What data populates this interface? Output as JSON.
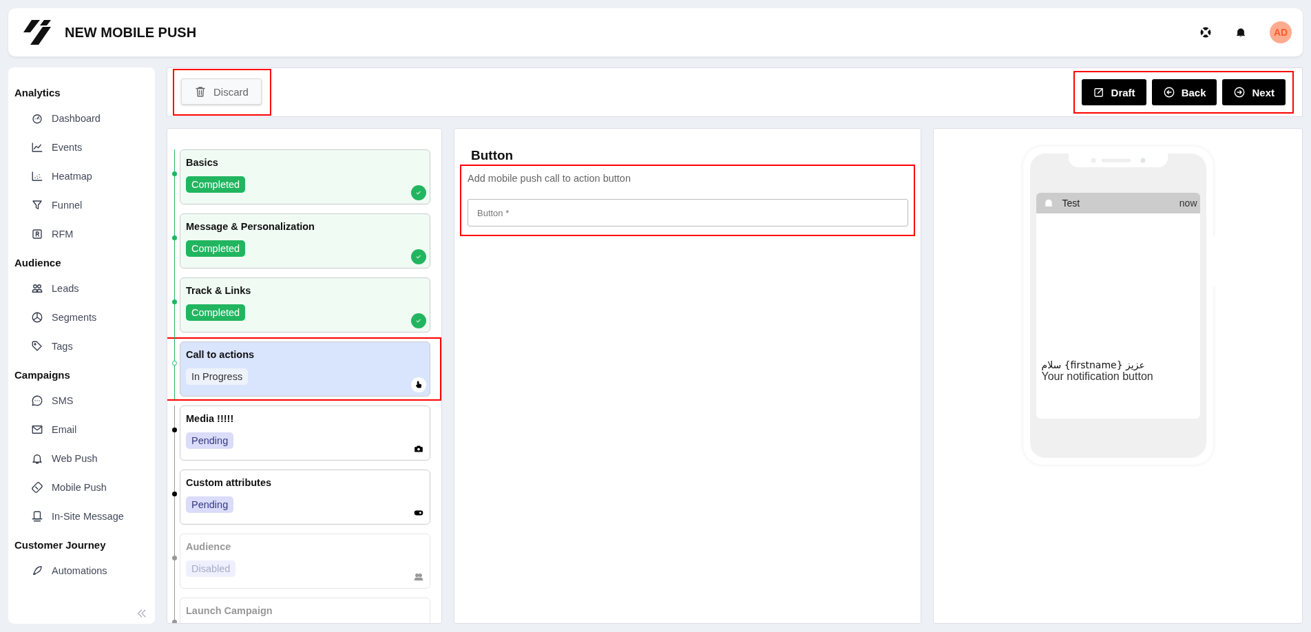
{
  "header": {
    "title": "NEW MOBILE PUSH",
    "avatar": "AD"
  },
  "sidebar": {
    "sections": [
      {
        "title": "Analytics",
        "items": [
          "Dashboard",
          "Events",
          "Heatmap",
          "Funnel",
          "RFM"
        ]
      },
      {
        "title": "Audience",
        "items": [
          "Leads",
          "Segments",
          "Tags"
        ]
      },
      {
        "title": "Campaigns",
        "items": [
          "SMS",
          "Email",
          "Web Push",
          "Mobile Push",
          "In-Site Message"
        ]
      },
      {
        "title": "Customer Journey",
        "items": [
          "Automations"
        ]
      }
    ]
  },
  "toolbar": {
    "discard": "Discard",
    "actions": [
      "Draft",
      "Back",
      "Next"
    ]
  },
  "steps": [
    {
      "title": "Basics",
      "kind": "completed",
      "status_label": "Completed"
    },
    {
      "title": "Message & Personalization",
      "kind": "completed",
      "status_label": "Completed"
    },
    {
      "title": "Track & Links",
      "kind": "completed",
      "status_label": "Completed"
    },
    {
      "title": "Call to actions",
      "kind": "current",
      "status_label": "In Progress"
    },
    {
      "title": "Media !!!!!",
      "kind": "pending",
      "status_label": "Pending"
    },
    {
      "title": "Custom attributes",
      "kind": "pending",
      "status_label": "Pending"
    },
    {
      "title": "Audience",
      "kind": "disabled",
      "status_label": "Disabled"
    },
    {
      "title": "Launch Campaign",
      "kind": "disabled"
    }
  ],
  "editor": {
    "title": "Button",
    "description": "Add mobile push call to action button",
    "field": {
      "placeholder": "Button *"
    }
  },
  "preview": {
    "app": "Test",
    "time": "now",
    "title": "سلام {firstname} عزیز",
    "body": "Your notification button"
  }
}
